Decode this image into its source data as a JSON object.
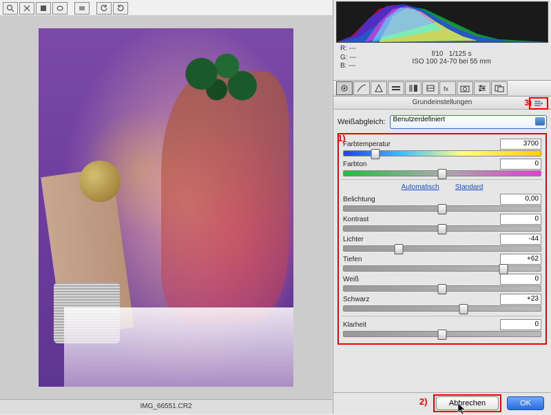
{
  "filename": "IMG_66551.CR2",
  "readouts": {
    "r": "R:   ---",
    "g": "G:   ---",
    "b": "B:   ---",
    "aperture": "f/10",
    "shutter": "1/125 s",
    "iso_lens": "ISO 100   24-70 bei 55 mm"
  },
  "section_title": "Grundeinstellungen",
  "whitebalance": {
    "label": "Weißabgleich:",
    "selected": "Benutzerdefiniert"
  },
  "presets": {
    "auto": "Automatisch",
    "default": "Standard"
  },
  "sliders": {
    "temp": {
      "label": "Farbtemperatur",
      "value": "3700",
      "pos": 16
    },
    "tint": {
      "label": "Farbton",
      "value": "0",
      "pos": 50
    },
    "exposure": {
      "label": "Belichtung",
      "value": "0,00",
      "pos": 50
    },
    "contrast": {
      "label": "Kontrast",
      "value": "0",
      "pos": 50
    },
    "highlights": {
      "label": "Lichter",
      "value": "-44",
      "pos": 28
    },
    "shadows": {
      "label": "Tiefen",
      "value": "+62",
      "pos": 81
    },
    "whites": {
      "label": "Weiß",
      "value": "0",
      "pos": 50
    },
    "blacks": {
      "label": "Schwarz",
      "value": "+23",
      "pos": 61
    },
    "clarity": {
      "label": "Klarheit",
      "value": "0",
      "pos": 50
    }
  },
  "buttons": {
    "cancel": "Abbrechen",
    "ok": "OK"
  },
  "annotations": {
    "a1": "1)",
    "a2": "2)",
    "a3": "3)"
  }
}
